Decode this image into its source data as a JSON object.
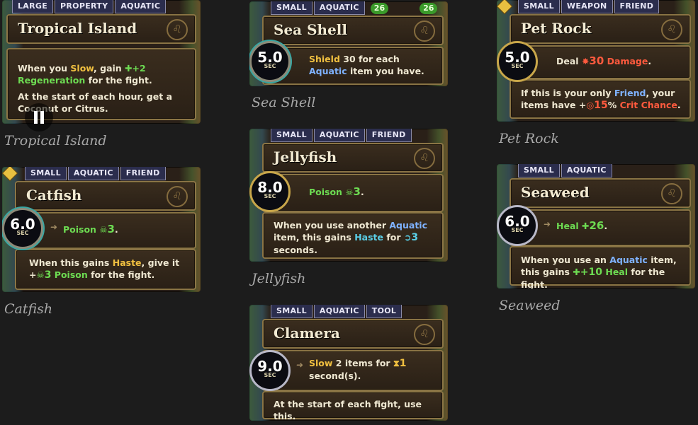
{
  "cards": {
    "tropical_island": {
      "tags": [
        "LARGE",
        "PROPERTY",
        "AQUATIC"
      ],
      "title": "Tropical Island",
      "l1a": "When you ",
      "l1slow": "Slow",
      "l1b": ", gain ",
      "l1val": "+2",
      "l2regen": "Regeneration",
      "l2b": " for the fight.",
      "l3": "At the start of each hour, get a Coconut or Citrus.",
      "caption": "Tropical Island"
    },
    "sea_shell": {
      "tags": [
        "SMALL",
        "AQUATIC"
      ],
      "counts": [
        "26",
        "26"
      ],
      "cooldown": "5.0",
      "unit": "SEC",
      "title": "Sea Shell",
      "shield": "Shield",
      "a": " 30 for each ",
      "aquatic": "Aquatic",
      "b": " item you have.",
      "caption": "Sea Shell"
    },
    "pet_rock": {
      "tags": [
        "SMALL",
        "WEAPON",
        "FRIEND"
      ],
      "cooldown": "5.0",
      "unit": "SEC",
      "title": "Pet Rock",
      "deal": "Deal ",
      "dmg_val": "30",
      "dmg": " Damage",
      "dot": ".",
      "l2a": "If this is your only ",
      "friend": "Friend",
      "l2b": ", your items have +",
      "crit_val": "15",
      "pct": "%",
      "crit": " Crit Chance",
      "dot2": ".",
      "caption": "Pet Rock"
    },
    "jellyfish": {
      "tags": [
        "SMALL",
        "AQUATIC",
        "FRIEND"
      ],
      "cooldown": "8.0",
      "unit": "SEC",
      "title": "Jellyfish",
      "poison": "Poison ",
      "poison_val": "3",
      "dot": ".",
      "l2a": "When you use another ",
      "aquatic": "Aquatic",
      "l2b": " item, this gains ",
      "haste": "Haste",
      "l2c": " for ",
      "haste_val": "3",
      "l2d": " seconds.",
      "caption": "Jellyfish"
    },
    "catfish": {
      "tags": [
        "SMALL",
        "AQUATIC",
        "FRIEND"
      ],
      "cooldown": "6.0",
      "unit": "SEC",
      "title": "Catfish",
      "poison": "Poison ",
      "poison_val": "3",
      "dot": ".",
      "l2a": "When this gains ",
      "haste": "Haste",
      "l2b": ", give it +",
      "poison2_val": "3",
      "poison2": " Poison",
      "l2c": " for the fight.",
      "caption": "Catfish"
    },
    "seaweed": {
      "tags": [
        "SMALL",
        "AQUATIC"
      ],
      "cooldown": "6.0",
      "unit": "SEC",
      "title": "Seaweed",
      "heal": "Heal ",
      "heal_val": "26",
      "dot": ".",
      "l2a": "When you use an ",
      "aquatic": "Aquatic",
      "l2b": " item, this gains ",
      "heal2_val": "+10",
      "heal2": " Heal",
      "l2c": " for the fight.",
      "caption": "Seaweed"
    },
    "clamera": {
      "tags": [
        "SMALL",
        "AQUATIC",
        "TOOL"
      ],
      "cooldown": "9.0",
      "unit": "SEC",
      "title": "Clamera",
      "slow": "Slow",
      "a": " 2 items for ",
      "slow_val": "1",
      "b": " second(s).",
      "l2": "At the start of each fight, use this.",
      "caption": "Clamera"
    }
  },
  "icons": {
    "crest": "lion-crest-icon",
    "poison": "skull-icon",
    "heal": "cross-icon",
    "haste": "wing-icon",
    "damage": "burst-icon",
    "crit": "target-icon",
    "slow": "hourglass-icon",
    "regen": "plus-icon",
    "pause": "pause-icon"
  }
}
